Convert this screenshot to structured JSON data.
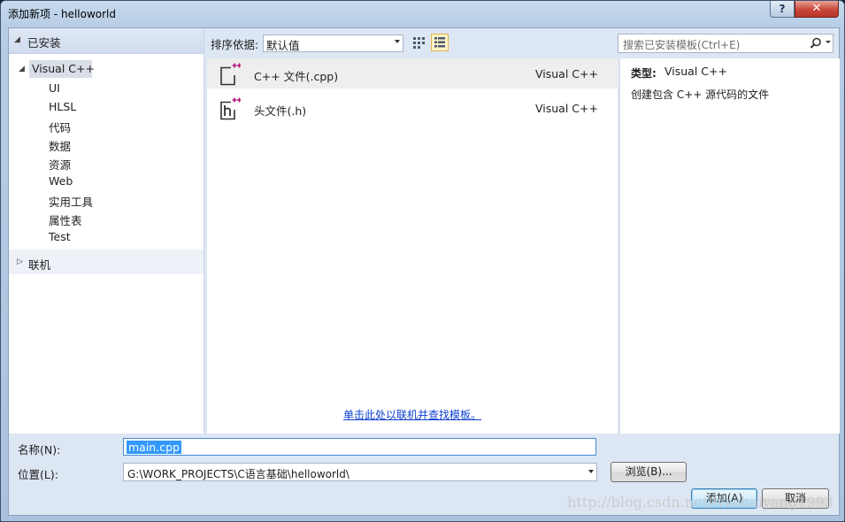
{
  "window": {
    "title": "添加新项 - helloworld",
    "help_glyph": "?",
    "close_glyph": "✕"
  },
  "tree": {
    "installed_label": "已安装",
    "root_label": "Visual C++",
    "children": [
      "UI",
      "HLSL",
      "代码",
      "数据",
      "资源",
      "Web",
      "实用工具",
      "属性表",
      "Test"
    ],
    "online_label": "联机"
  },
  "toolbar": {
    "sort_label": "排序依据:",
    "sort_value": "默认值",
    "search_placeholder": "搜索已安装模板(Ctrl+E)",
    "views": [
      "grid-view-icon",
      "list-view-icon"
    ],
    "active_view": "list-view-icon"
  },
  "templates": [
    {
      "name": "C++ 文件(.cpp)",
      "language": "Visual C++",
      "icon": "cpp-file-icon",
      "selected": true
    },
    {
      "name": "头文件(.h)",
      "language": "Visual C++",
      "icon": "header-file-icon",
      "selected": false
    }
  ],
  "online_link": "单击此处以联机并查找模板。",
  "details": {
    "type_label": "类型:",
    "type_value": "Visual C++",
    "description": "创建包含 C++ 源代码的文件"
  },
  "form": {
    "name_label": "名称(N):",
    "name_value": "main.cpp",
    "location_label": "位置(L):",
    "location_value": "G:\\WORK_PROJECTS\\C语言基础\\helloworld\\",
    "browse_label": "浏览(B)...",
    "add_label": "添加(A)",
    "cancel_label": "取消"
  },
  "watermark": "http://blog.csdn.net/lvsehaiyang1993",
  "colors": {
    "accent": "#3399ff",
    "link": "#0d3fd1",
    "close": "#c9463a",
    "icon_plus": "#b4127a"
  }
}
